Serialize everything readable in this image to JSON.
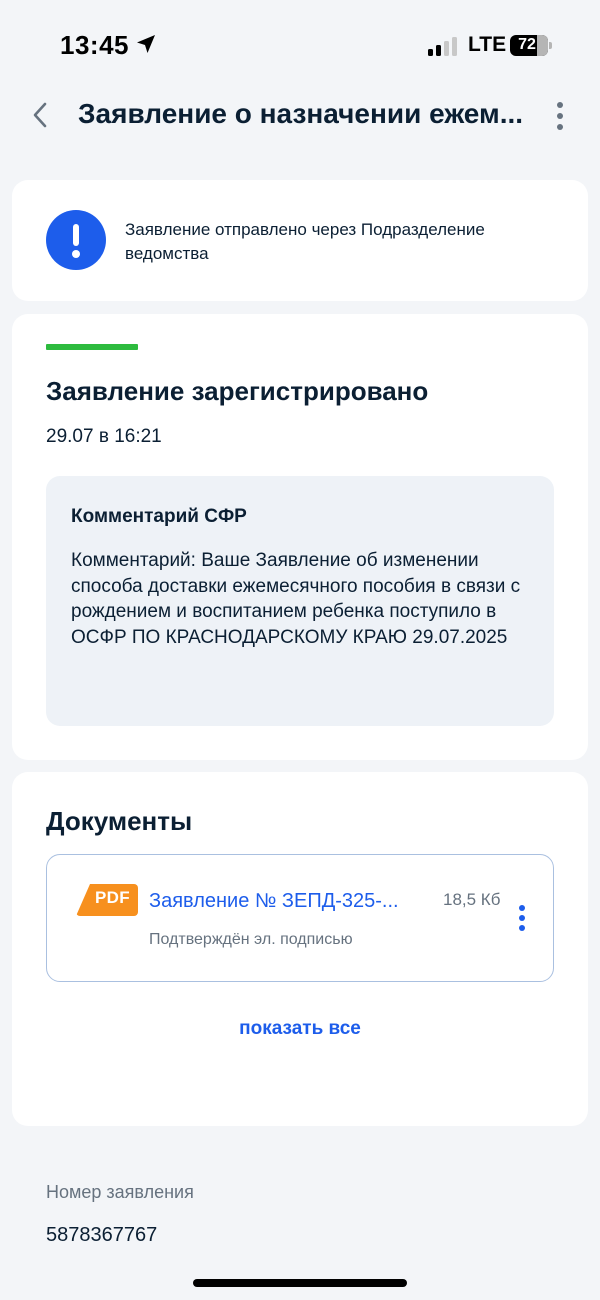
{
  "status_bar": {
    "time": "13:45",
    "network": "LTE",
    "battery": "72",
    "battery_level": 0.72
  },
  "header": {
    "title": "Заявление о назначении ежем...",
    "back_icon": "chevron-left-icon",
    "menu_icon": "more-vertical-icon"
  },
  "info": {
    "icon": "exclamation-icon",
    "text": "Заявление отправлено через Подразделение ведомства",
    "accent": "#1d5deb"
  },
  "status": {
    "title": "Заявление зарегистрировано",
    "date": "29.07 в 16:21",
    "status_color": "#2dbb3e",
    "comment_title": "Комментарий СФР",
    "comment_text": "Комментарий: Ваше Заявление об изменении способа доставки ежемесячного пособия в связи с рождением и воспитанием ребенка поступило в ОСФР ПО КРАСНОДАРСКОМУ КРАЮ 29.07.2025"
  },
  "documents": {
    "title": "Документы",
    "items": [
      {
        "type": "PDF",
        "name": "Заявление № ЗЕПД-325-...",
        "size": "18,5 Кб",
        "subtitle": "Подтверждён эл. подписью"
      }
    ],
    "show_all": "показать все"
  },
  "application": {
    "number_label": "Номер заявления",
    "number": "5878367767"
  }
}
